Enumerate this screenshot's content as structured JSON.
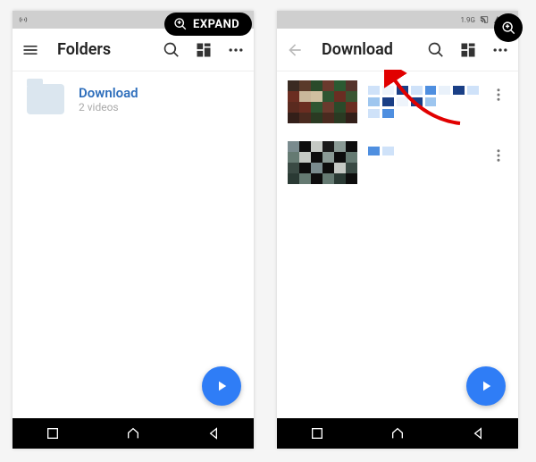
{
  "overlay": {
    "expand_label": "EXPAND"
  },
  "left": {
    "title": "Folders",
    "folder": {
      "name": "Download",
      "subtitle": "2 videos"
    }
  },
  "right": {
    "title": "Download"
  }
}
